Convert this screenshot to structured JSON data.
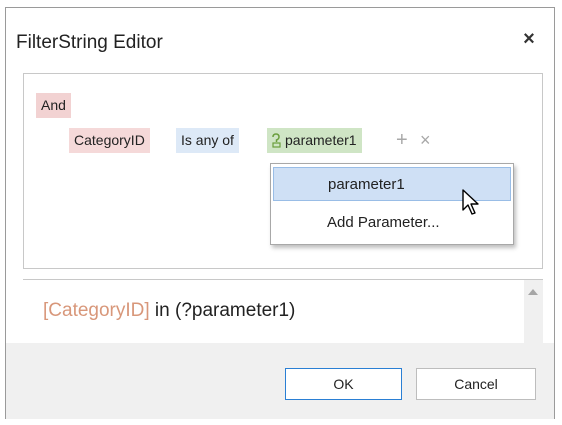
{
  "dialog": {
    "title": "FilterString Editor",
    "close_glyph": "×"
  },
  "filter": {
    "group_label": "And",
    "field": "CategoryID",
    "operator": "Is any of",
    "parameter": "parameter1",
    "add_glyph": "+",
    "remove_glyph": "×"
  },
  "dropdown": {
    "items": [
      "parameter1",
      "Add Parameter..."
    ]
  },
  "expression": {
    "field_part": "[CategoryID]",
    "rest_part": " in (?parameter1)"
  },
  "buttons": {
    "ok": "OK",
    "cancel": "Cancel"
  },
  "colors": {
    "group_bg": "#f2d2d2",
    "field_bg": "#f5d9d9",
    "operator_bg": "#dde9f7",
    "parameter_bg": "#cfe5c5",
    "selected_item": "#cfe0f5",
    "ok_border": "#2a7fd4"
  },
  "icons": {
    "parameter": "parameter-icon",
    "cursor": "mouse-pointer-icon"
  }
}
